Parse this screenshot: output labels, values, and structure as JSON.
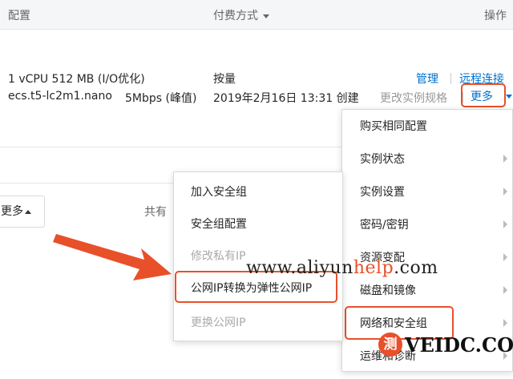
{
  "table_header": {
    "config": "配置",
    "billing": "付费方式",
    "actions": "操作"
  },
  "row": {
    "spec": "1 vCPU 512 MB (I/O优化)",
    "instance_type": "ecs.t5-lc2m1.nano",
    "bandwidth": "5Mbps (峰值)",
    "billing_mode": "按量",
    "created": "2019年2月16日 13:31 创建",
    "manage": "管理",
    "remote": "远程连接",
    "change_spec": "更改实例规格",
    "more": "更多"
  },
  "footer": {
    "more_button": "更多",
    "total_prefix": "共有"
  },
  "more_menu": [
    {
      "label": "购买相同配置"
    },
    {
      "label": "实例状态"
    },
    {
      "label": "实例设置"
    },
    {
      "label": "密码/密钥"
    },
    {
      "label": "资源变配"
    },
    {
      "label": "磁盘和镜像"
    },
    {
      "label": "网络和安全组"
    },
    {
      "label": "运维和诊断"
    }
  ],
  "network_submenu": [
    {
      "label": "加入安全组"
    },
    {
      "label": "安全组配置"
    },
    {
      "label": "修改私有IP"
    },
    {
      "label": "公网IP转换为弹性公网IP"
    },
    {
      "label": "更换公网IP"
    }
  ],
  "watermark": {
    "pre": "www.aliyun",
    "highlight": "help",
    "post": ".com"
  },
  "logo": {
    "badge": "测",
    "text": "VEIDC.COM"
  },
  "colors": {
    "link": "#0070cc",
    "highlight": "#e8502a"
  }
}
